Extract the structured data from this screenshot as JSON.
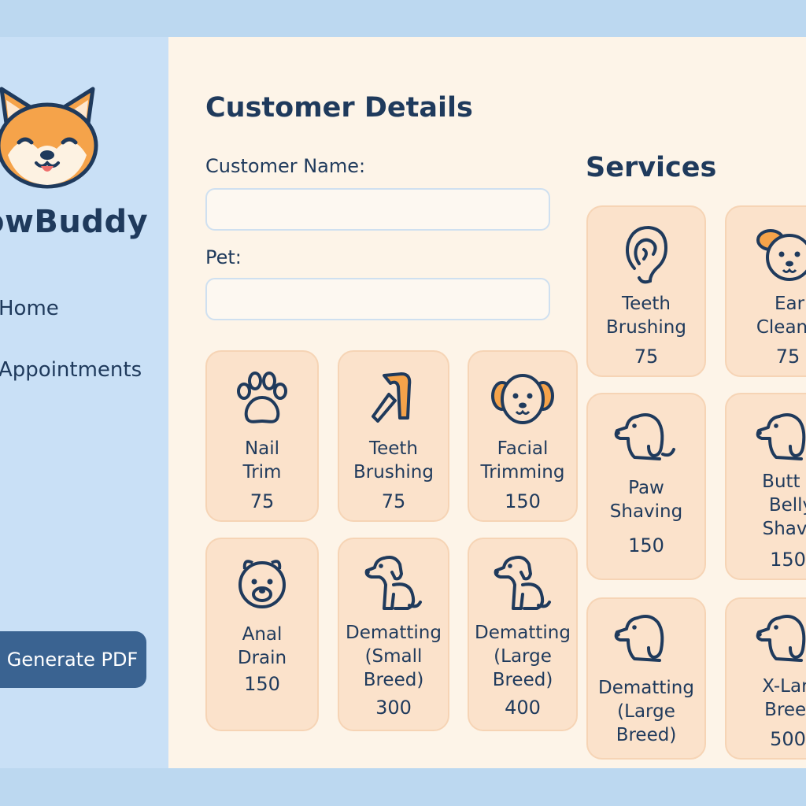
{
  "app": {
    "brand": "owBuddy"
  },
  "sidebar": {
    "items": [
      {
        "label": "Home"
      },
      {
        "label": "Appointments"
      }
    ],
    "generate_pdf_label": "Generate PDF"
  },
  "form": {
    "title": "Customer Details",
    "customer_name_label": "Customer Name:",
    "customer_name_value": "",
    "pet_label": "Pet:",
    "pet_value": ""
  },
  "grid_services": [
    {
      "name": "Nail\nTrim",
      "price": "75",
      "icon": "paw-icon"
    },
    {
      "name": "Teeth\nBrushing",
      "price": "75",
      "icon": "toothbrush-icon"
    },
    {
      "name": "Facial\nTrimming",
      "price": "150",
      "icon": "dog-face-icon"
    },
    {
      "name": "Anal\nDrain",
      "price": "150",
      "icon": "bear-face-icon"
    },
    {
      "name": "Dematting\n(Small\nBreed)",
      "price": "300",
      "icon": "sitting-dog-icon"
    },
    {
      "name": "Dematting\n(Large\nBreed)",
      "price": "400",
      "icon": "sitting-dog-icon"
    }
  ],
  "services_panel": {
    "title": "Services",
    "items": [
      {
        "name": "Teeth\nBrushing",
        "price": "75",
        "icon": "ear-icon"
      },
      {
        "name": "Ear\nCleanic",
        "price": "75",
        "icon": "dog-face-icon"
      },
      {
        "name": "Paw\nShaving",
        "price": "150",
        "icon": "dog-head-icon"
      },
      {
        "name": "Butt &\nBelly\nShavir",
        "price": "150",
        "icon": "dog-head-icon"
      },
      {
        "name": "Dematting\n(Large\nBreed)",
        "price": "",
        "icon": "dog-head-icon"
      },
      {
        "name": "X-Larg\nBreed",
        "price": "500",
        "icon": "dog-head-icon"
      }
    ]
  },
  "colors": {
    "background": "#bcd8f0",
    "sidebar": "#c9e0f6",
    "content": "#fdf4e8",
    "card": "#fbe2cb",
    "text": "#1f3a5c",
    "button": "#3a6391",
    "accent": "#f5a34a"
  }
}
